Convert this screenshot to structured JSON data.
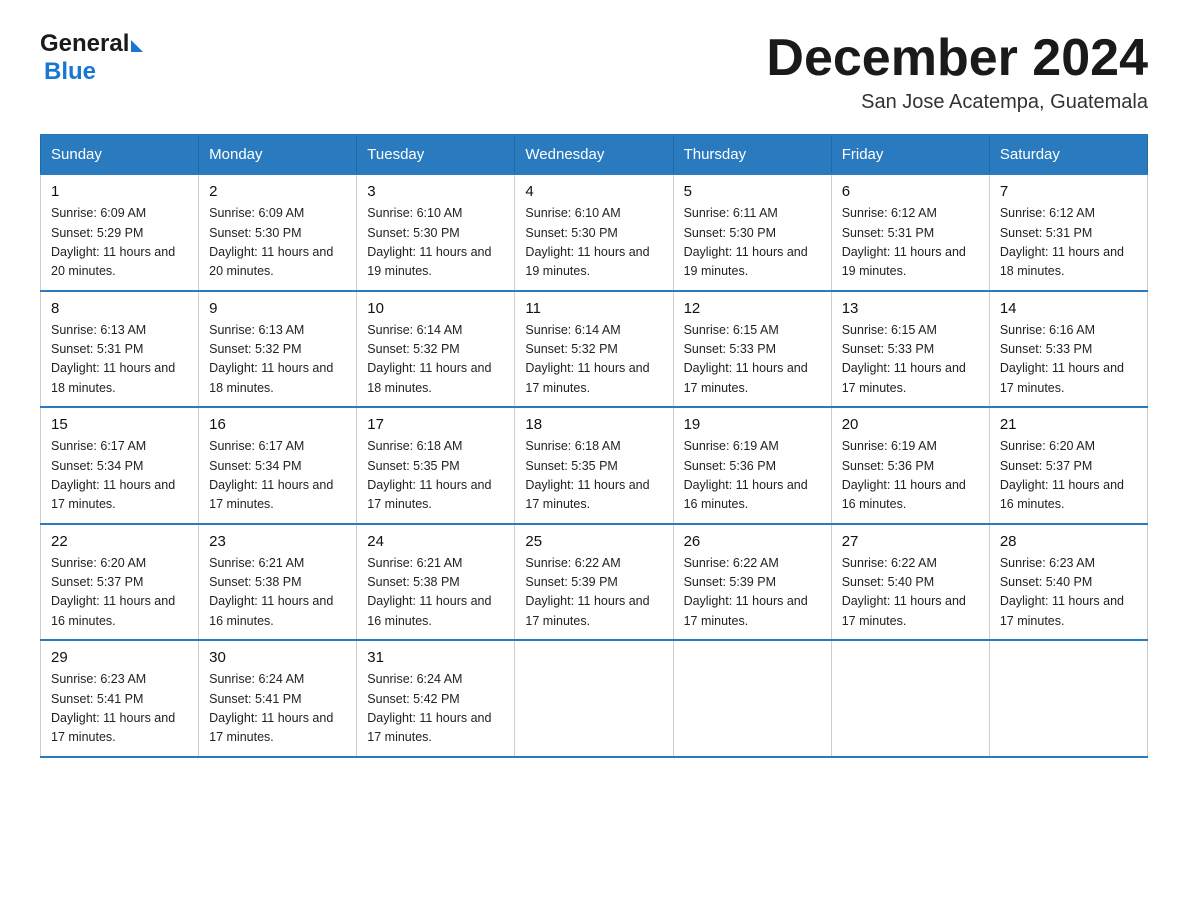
{
  "header": {
    "logo_general": "General",
    "logo_blue": "Blue",
    "month_title": "December 2024",
    "location": "San Jose Acatempa, Guatemala"
  },
  "days_of_week": [
    "Sunday",
    "Monday",
    "Tuesday",
    "Wednesday",
    "Thursday",
    "Friday",
    "Saturday"
  ],
  "weeks": [
    [
      {
        "day": "1",
        "sunrise": "6:09 AM",
        "sunset": "5:29 PM",
        "daylight": "11 hours and 20 minutes."
      },
      {
        "day": "2",
        "sunrise": "6:09 AM",
        "sunset": "5:30 PM",
        "daylight": "11 hours and 20 minutes."
      },
      {
        "day": "3",
        "sunrise": "6:10 AM",
        "sunset": "5:30 PM",
        "daylight": "11 hours and 19 minutes."
      },
      {
        "day": "4",
        "sunrise": "6:10 AM",
        "sunset": "5:30 PM",
        "daylight": "11 hours and 19 minutes."
      },
      {
        "day": "5",
        "sunrise": "6:11 AM",
        "sunset": "5:30 PM",
        "daylight": "11 hours and 19 minutes."
      },
      {
        "day": "6",
        "sunrise": "6:12 AM",
        "sunset": "5:31 PM",
        "daylight": "11 hours and 19 minutes."
      },
      {
        "day": "7",
        "sunrise": "6:12 AM",
        "sunset": "5:31 PM",
        "daylight": "11 hours and 18 minutes."
      }
    ],
    [
      {
        "day": "8",
        "sunrise": "6:13 AM",
        "sunset": "5:31 PM",
        "daylight": "11 hours and 18 minutes."
      },
      {
        "day": "9",
        "sunrise": "6:13 AM",
        "sunset": "5:32 PM",
        "daylight": "11 hours and 18 minutes."
      },
      {
        "day": "10",
        "sunrise": "6:14 AM",
        "sunset": "5:32 PM",
        "daylight": "11 hours and 18 minutes."
      },
      {
        "day": "11",
        "sunrise": "6:14 AM",
        "sunset": "5:32 PM",
        "daylight": "11 hours and 17 minutes."
      },
      {
        "day": "12",
        "sunrise": "6:15 AM",
        "sunset": "5:33 PM",
        "daylight": "11 hours and 17 minutes."
      },
      {
        "day": "13",
        "sunrise": "6:15 AM",
        "sunset": "5:33 PM",
        "daylight": "11 hours and 17 minutes."
      },
      {
        "day": "14",
        "sunrise": "6:16 AM",
        "sunset": "5:33 PM",
        "daylight": "11 hours and 17 minutes."
      }
    ],
    [
      {
        "day": "15",
        "sunrise": "6:17 AM",
        "sunset": "5:34 PM",
        "daylight": "11 hours and 17 minutes."
      },
      {
        "day": "16",
        "sunrise": "6:17 AM",
        "sunset": "5:34 PM",
        "daylight": "11 hours and 17 minutes."
      },
      {
        "day": "17",
        "sunrise": "6:18 AM",
        "sunset": "5:35 PM",
        "daylight": "11 hours and 17 minutes."
      },
      {
        "day": "18",
        "sunrise": "6:18 AM",
        "sunset": "5:35 PM",
        "daylight": "11 hours and 17 minutes."
      },
      {
        "day": "19",
        "sunrise": "6:19 AM",
        "sunset": "5:36 PM",
        "daylight": "11 hours and 16 minutes."
      },
      {
        "day": "20",
        "sunrise": "6:19 AM",
        "sunset": "5:36 PM",
        "daylight": "11 hours and 16 minutes."
      },
      {
        "day": "21",
        "sunrise": "6:20 AM",
        "sunset": "5:37 PM",
        "daylight": "11 hours and 16 minutes."
      }
    ],
    [
      {
        "day": "22",
        "sunrise": "6:20 AM",
        "sunset": "5:37 PM",
        "daylight": "11 hours and 16 minutes."
      },
      {
        "day": "23",
        "sunrise": "6:21 AM",
        "sunset": "5:38 PM",
        "daylight": "11 hours and 16 minutes."
      },
      {
        "day": "24",
        "sunrise": "6:21 AM",
        "sunset": "5:38 PM",
        "daylight": "11 hours and 16 minutes."
      },
      {
        "day": "25",
        "sunrise": "6:22 AM",
        "sunset": "5:39 PM",
        "daylight": "11 hours and 17 minutes."
      },
      {
        "day": "26",
        "sunrise": "6:22 AM",
        "sunset": "5:39 PM",
        "daylight": "11 hours and 17 minutes."
      },
      {
        "day": "27",
        "sunrise": "6:22 AM",
        "sunset": "5:40 PM",
        "daylight": "11 hours and 17 minutes."
      },
      {
        "day": "28",
        "sunrise": "6:23 AM",
        "sunset": "5:40 PM",
        "daylight": "11 hours and 17 minutes."
      }
    ],
    [
      {
        "day": "29",
        "sunrise": "6:23 AM",
        "sunset": "5:41 PM",
        "daylight": "11 hours and 17 minutes."
      },
      {
        "day": "30",
        "sunrise": "6:24 AM",
        "sunset": "5:41 PM",
        "daylight": "11 hours and 17 minutes."
      },
      {
        "day": "31",
        "sunrise": "6:24 AM",
        "sunset": "5:42 PM",
        "daylight": "11 hours and 17 minutes."
      },
      null,
      null,
      null,
      null
    ]
  ]
}
